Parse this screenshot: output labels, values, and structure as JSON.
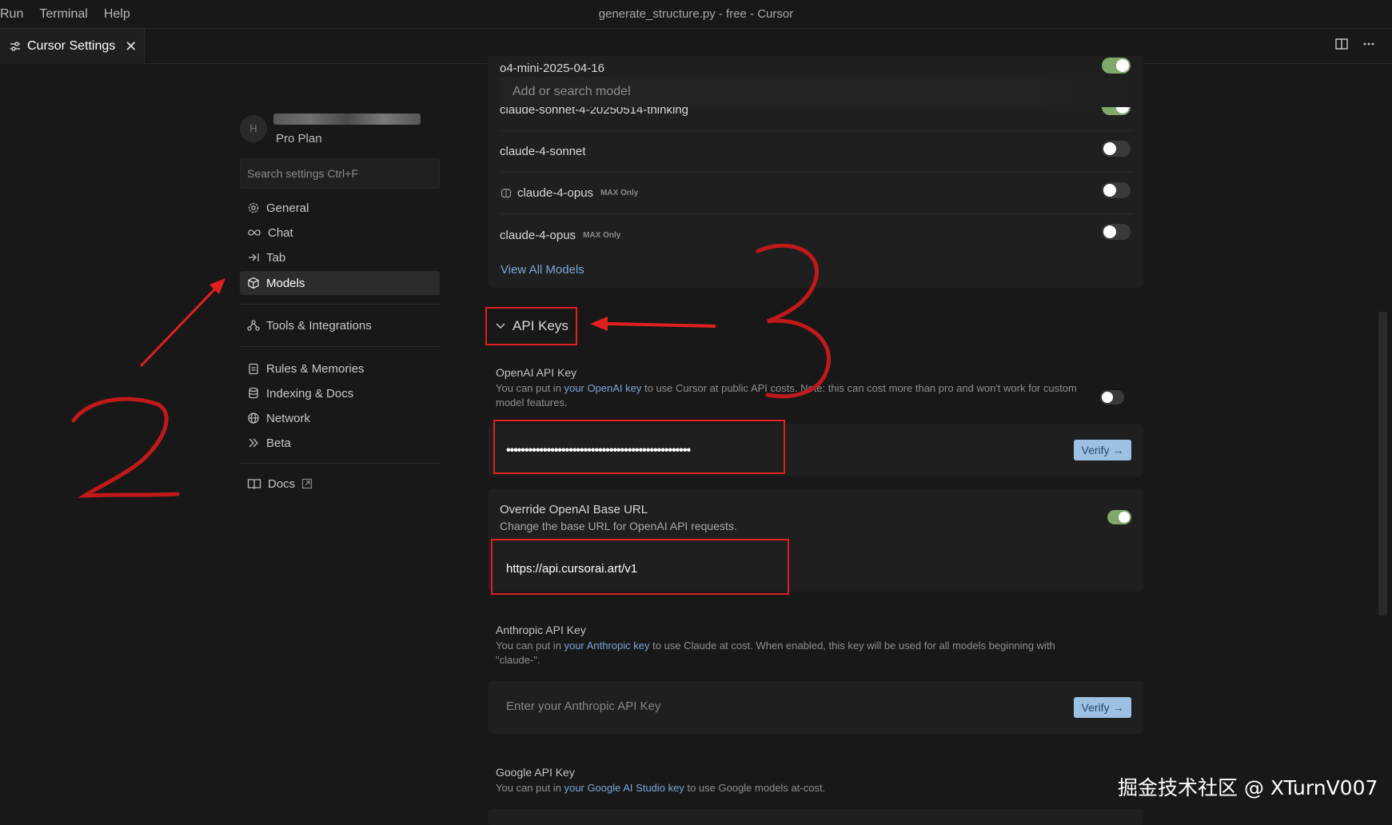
{
  "menu": {
    "run": "Run",
    "terminal": "Terminal",
    "help": "Help"
  },
  "window_title": "generate_structure.py - free - Cursor",
  "tab": {
    "label": "Cursor Settings",
    "close": "✕"
  },
  "profile": {
    "avatar_initial": "H",
    "plan": "Pro Plan"
  },
  "search_settings": {
    "placeholder": "Search settings Ctrl+F"
  },
  "nav": {
    "general": "General",
    "chat": "Chat",
    "tab": "Tab",
    "models": "Models",
    "tools": "Tools & Integrations",
    "rules": "Rules & Memories",
    "indexing": "Indexing & Docs",
    "network": "Network",
    "beta": "Beta",
    "docs": "Docs"
  },
  "models": {
    "search_placeholder": "Add or search model",
    "rows": [
      {
        "name": "o4-mini-2025-04-16",
        "enabled": true
      },
      {
        "name": "claude-sonnet-4-20250514-thinking",
        "enabled": true
      },
      {
        "name": "claude-4-sonnet",
        "enabled": false
      },
      {
        "name": "claude-4-opus",
        "badge": "MAX Only",
        "enabled": false,
        "icon": "brain-icon"
      },
      {
        "name": "claude-4-opus",
        "badge": "MAX Only",
        "enabled": false
      }
    ],
    "view_all": "View All Models"
  },
  "api_keys": {
    "header": "API Keys",
    "openai": {
      "title": "OpenAI API Key",
      "desc_prefix": "You can put in ",
      "desc_link": "your OpenAI key",
      "desc_suffix": " to use Cursor at public API costs. Note: this can cost more than pro and won't work for custom model features.",
      "enabled": false,
      "masked_value": "••••••••••••••••••••••••••••••••••••••••••••••••••",
      "verify": "Verify"
    },
    "override": {
      "title": "Override OpenAI Base URL",
      "desc": "Change the base URL for OpenAI API requests.",
      "enabled": true,
      "url": "https://api.cursorai.art/v1"
    },
    "anthropic": {
      "title": "Anthropic API Key",
      "desc_prefix": "You can put in ",
      "desc_link": "your Anthropic key",
      "desc_suffix": " to use Claude at cost. When enabled, this key will be used for all models beginning with \"claude-\".",
      "placeholder": "Enter your Anthropic API Key",
      "verify": "Verify"
    },
    "google": {
      "title": "Google API Key",
      "desc_prefix": "You can put in ",
      "desc_link": "your Google AI Studio key",
      "desc_suffix": " to use Google models at-cost."
    }
  },
  "watermark": "掘金技术社区 @ XTurnV007",
  "colors": {
    "accent_link": "#7aa7d8",
    "toggle_on": "#7fa86b",
    "annotation_red": "#e0201f",
    "verify_bg": "#9cc1e2"
  }
}
